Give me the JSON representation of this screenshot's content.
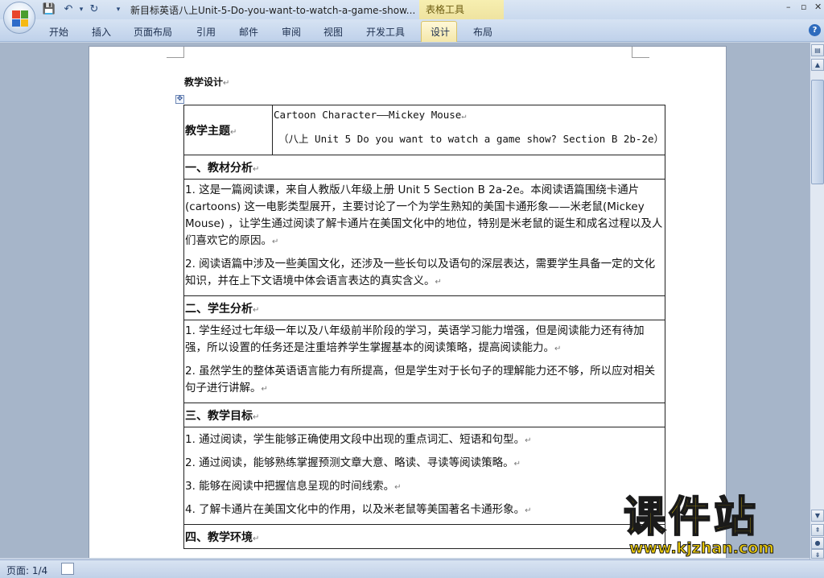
{
  "window": {
    "title": "新目标英语八上Unit-5-Do-you-want-to-watch-a-game-show...",
    "context_tab": "表格工具"
  },
  "ribbon": {
    "tabs": [
      "开始",
      "插入",
      "页面布局",
      "引用",
      "邮件",
      "审阅",
      "视图",
      "开发工具",
      "设计",
      "布局"
    ],
    "active_tab": "设计"
  },
  "document": {
    "heading": "教学设计",
    "theme_label": "教学主题",
    "theme_line1": "Cartoon Character——Mickey Mouse",
    "theme_line2": "（八上 Unit 5 Do you want to watch a game show? Section B 2b-2e）",
    "sections": [
      {
        "title": "一、教材分析",
        "paragraphs": [
          "1.  这是一篇阅读课，来自人教版八年级上册 Unit 5 Section B 2a-2e。本阅读语篇围绕卡通片(cartoons)  这一电影类型展开，主要讨论了一个为学生熟知的美国卡通形象——米老鼠(Mickey Mouse) ，让学生通过阅读了解卡通片在美国文化中的地位，特别是米老鼠的诞生和成名过程以及人们喜欢它的原因。",
          "2.  阅读语篇中涉及一些美国文化，还涉及一些长句以及语句的深层表达，需要学生具备一定的文化知识，并在上下文语境中体会语言表达的真实含义。"
        ]
      },
      {
        "title": "二、学生分析",
        "paragraphs": [
          "1.  学生经过七年级一年以及八年级前半阶段的学习，英语学习能力增强，但是阅读能力还有待加强，所以设置的任务还是注重培养学生掌握基本的阅读策略，提高阅读能力。",
          "2.  虽然学生的整体英语语言能力有所提高，但是学生对于长句子的理解能力还不够，所以应对相关句子进行讲解。"
        ]
      },
      {
        "title": "三、教学目标",
        "paragraphs": [
          "1.  通过阅读，学生能够正确使用文段中出现的重点词汇、短语和句型。",
          "2.  通过阅读，能够熟练掌握预测文章大意、略读、寻读等阅读策略。",
          "3.  能够在阅读中把握信息呈现的时间线索。",
          "4.  了解卡通片在美国文化中的作用，以及米老鼠等美国著名卡通形象。"
        ]
      },
      {
        "title": "四、教学环境",
        "paragraphs": []
      }
    ],
    "para_mark": "↵"
  },
  "status": {
    "page_count": "页面: 1/4"
  },
  "watermark": {
    "text": "课件站",
    "url": "www.kjzhan.com"
  }
}
